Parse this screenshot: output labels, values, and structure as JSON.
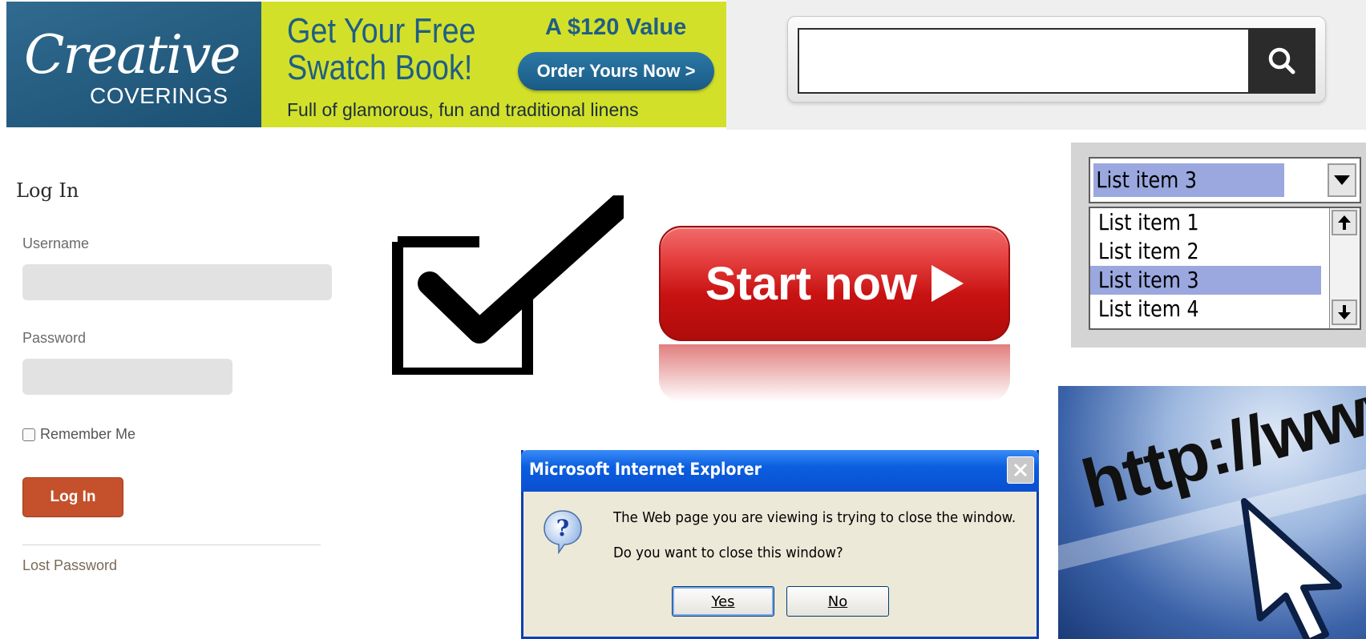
{
  "banner": {
    "logo_script": "Creative",
    "logo_sub": "COVERINGS",
    "headline_line1": "Get Your Free",
    "headline_line2": "Swatch Book!",
    "value": "A $120 Value",
    "cta": "Order Yours Now >",
    "tagline": "Full of glamorous, fun and traditional linens",
    "colors": {
      "brand_blue": "#1f5e86",
      "lime": "#d3e02a"
    }
  },
  "search": {
    "value": "",
    "placeholder": "",
    "button_icon": "search-icon"
  },
  "login": {
    "title": "Log In",
    "username_label": "Username",
    "password_label": "Password",
    "remember_label": "Remember Me",
    "remember_checked": false,
    "submit_label": "Log In",
    "lost_password": "Lost Password",
    "colors": {
      "button": "#c4512c"
    }
  },
  "checkbox_icon": {
    "icon": "checkbox-checked-icon"
  },
  "start_button": {
    "label": "Start now",
    "icon": "play-triangle-icon",
    "color": "#c81212"
  },
  "listbox": {
    "combo_value": "List item 3",
    "items": [
      "List item 1",
      "List item 2",
      "List item 3",
      "List item 4"
    ],
    "selected_index": 2,
    "highlight_color": "#9aa8df"
  },
  "dialog": {
    "title": "Microsoft Internet Explorer",
    "message_line1": "The Web page you are viewing is trying to close the window.",
    "message_line2": "Do you want to close this window?",
    "yes_label": "Yes",
    "no_label": "No",
    "icon": "question-icon"
  },
  "http_image": {
    "text": "http://www"
  }
}
